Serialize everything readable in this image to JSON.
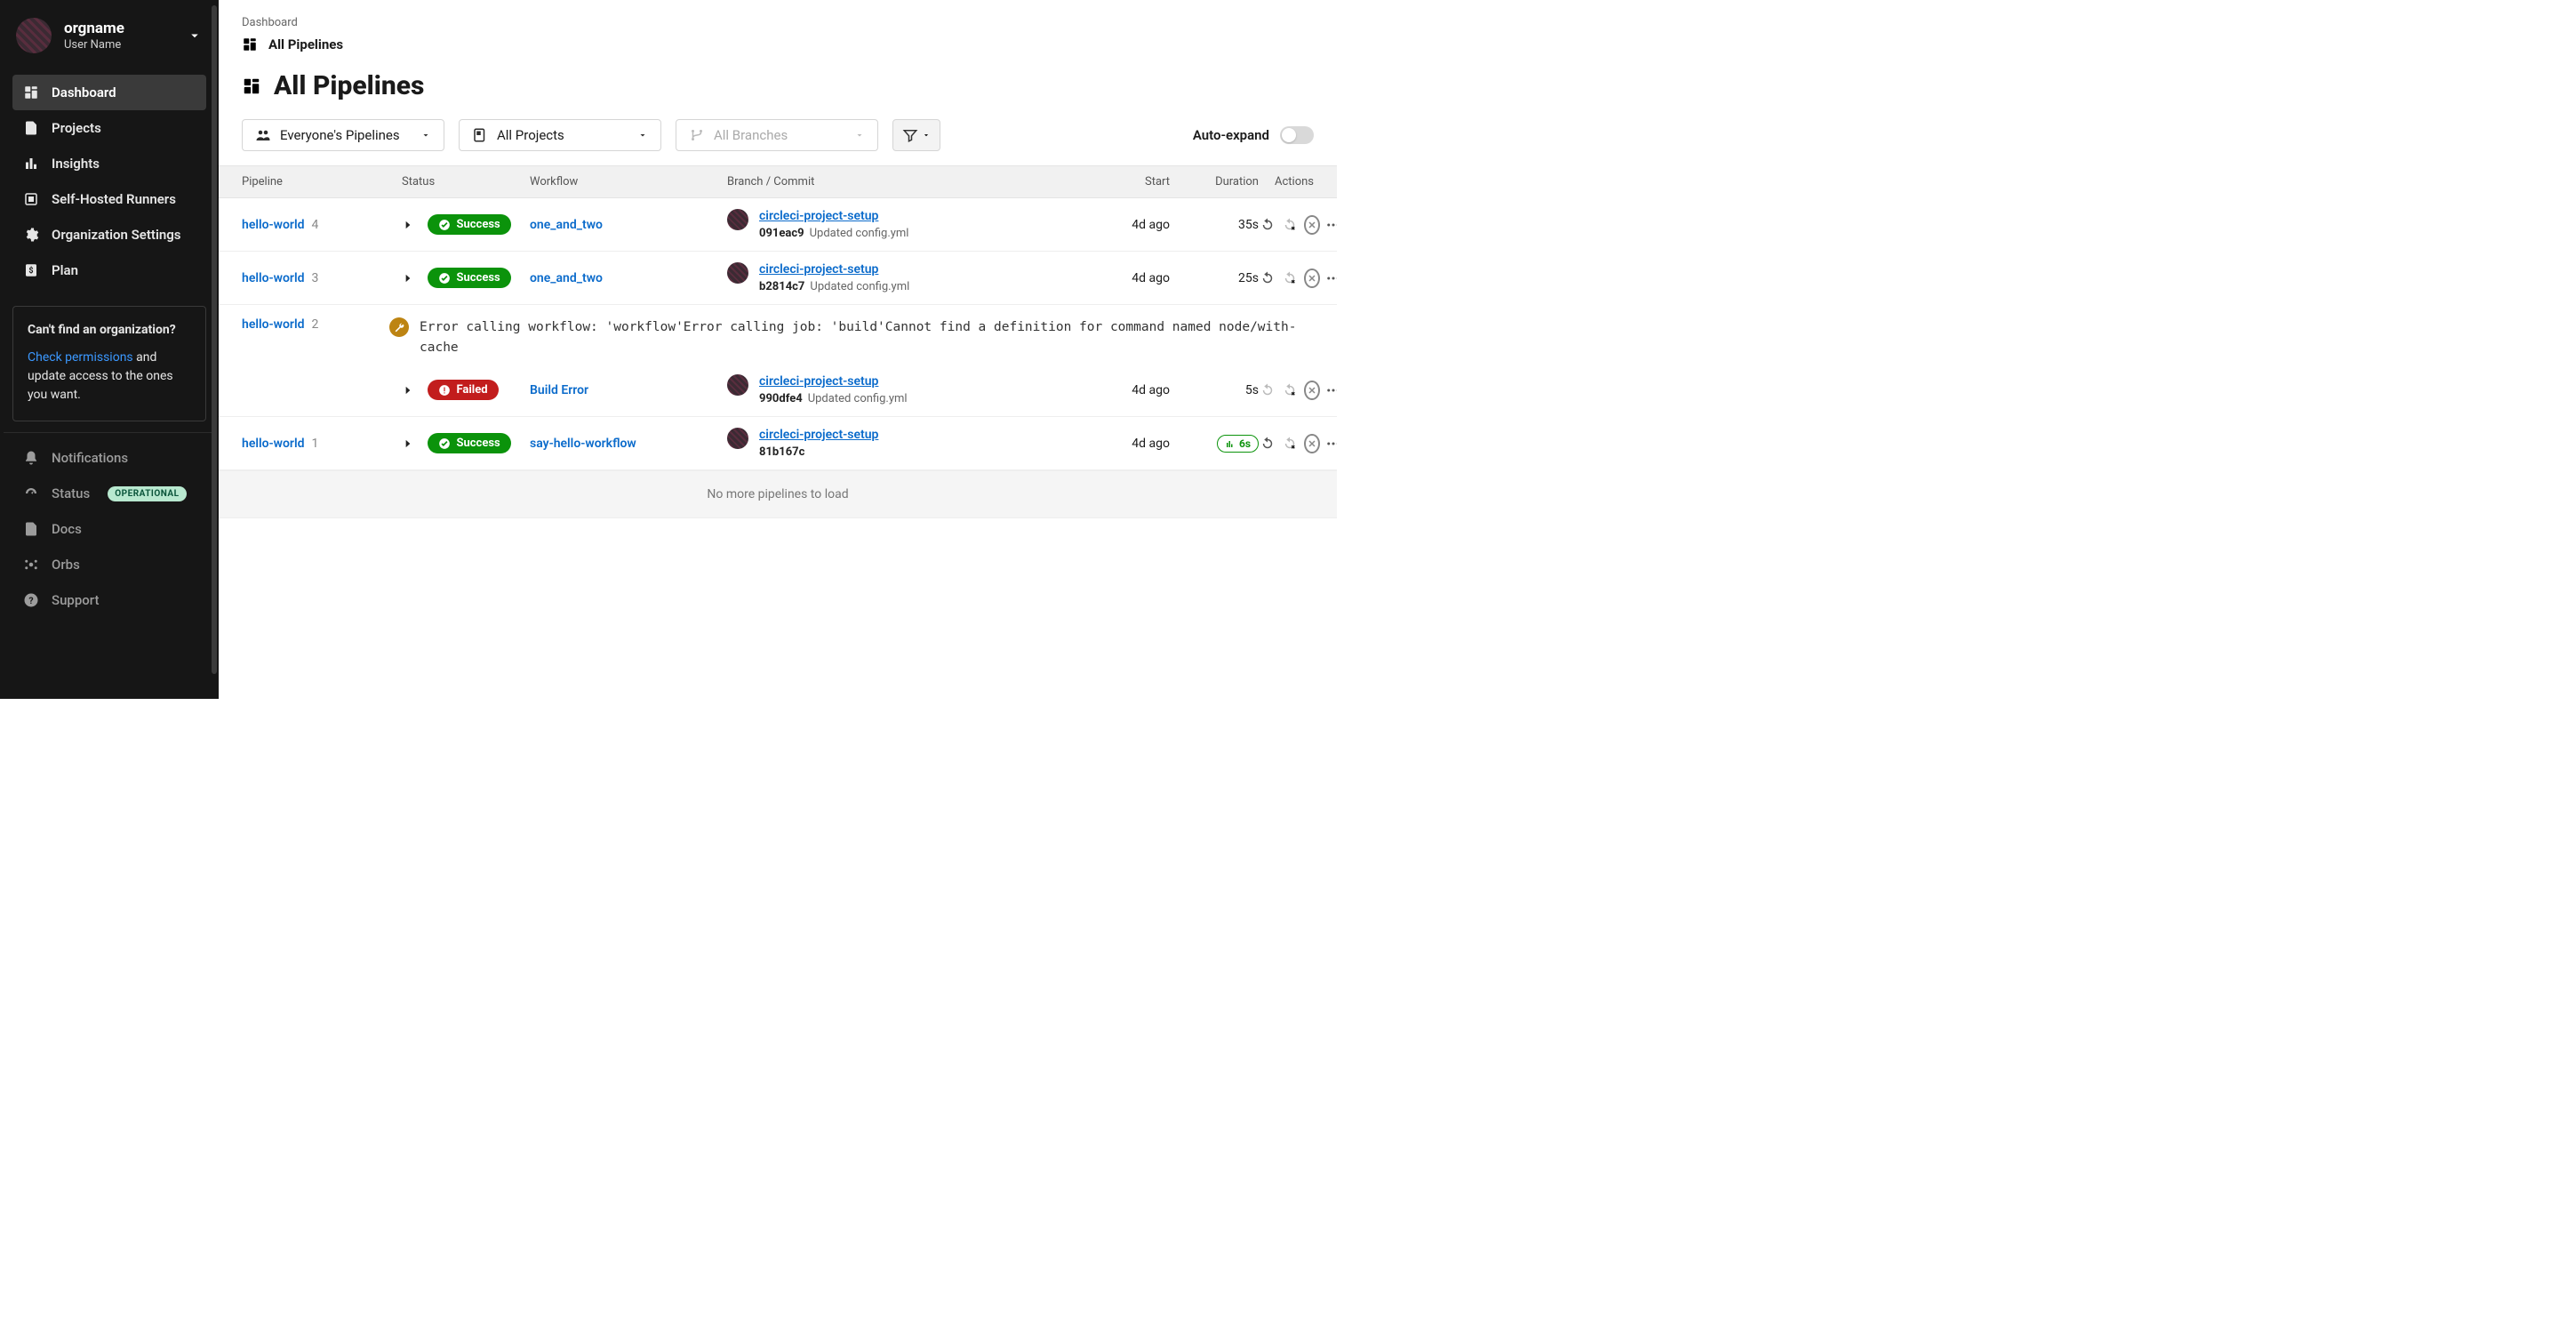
{
  "sidebar": {
    "org_name": "orgname",
    "user_name": "User Name",
    "nav_primary": [
      {
        "id": "dashboard",
        "label": "Dashboard"
      },
      {
        "id": "projects",
        "label": "Projects"
      },
      {
        "id": "insights",
        "label": "Insights"
      },
      {
        "id": "runners",
        "label": "Self-Hosted Runners"
      },
      {
        "id": "orgsettings",
        "label": "Organization Settings"
      },
      {
        "id": "plan",
        "label": "Plan"
      }
    ],
    "hint": {
      "title": "Can't find an organization?",
      "link_text": "Check permissions",
      "rest": " and update access to the ones you want."
    },
    "nav_secondary": [
      {
        "id": "notifications",
        "label": "Notifications"
      },
      {
        "id": "status",
        "label": "Status",
        "pill": "OPERATIONAL"
      },
      {
        "id": "docs",
        "label": "Docs"
      },
      {
        "id": "orbs",
        "label": "Orbs"
      },
      {
        "id": "support",
        "label": "Support"
      }
    ]
  },
  "main": {
    "breadcrumb": "Dashboard",
    "header_label": "All Pipelines",
    "page_title": "All Pipelines",
    "filters": {
      "owner": "Everyone's Pipelines",
      "project": "All Projects",
      "branch_placeholder": "All Branches"
    },
    "auto_expand_label": "Auto-expand",
    "columns": {
      "pipeline": "Pipeline",
      "status": "Status",
      "workflow": "Workflow",
      "branch": "Branch / Commit",
      "start": "Start",
      "duration": "Duration",
      "actions": "Actions"
    },
    "rows": [
      {
        "pipeline": "hello-world",
        "num": "4",
        "status": "Success",
        "status_kind": "success",
        "workflow": "one_and_two",
        "branch": "circleci-project-setup",
        "commit_sha": "091eac9",
        "commit_msg": "Updated config.yml",
        "start": "4d ago",
        "duration": "35s"
      },
      {
        "pipeline": "hello-world",
        "num": "3",
        "status": "Success",
        "status_kind": "success",
        "workflow": "one_and_two",
        "branch": "circleci-project-setup",
        "commit_sha": "b2814c7",
        "commit_msg": "Updated config.yml",
        "start": "4d ago",
        "duration": "25s"
      },
      {
        "pipeline": "hello-world",
        "num": "2",
        "status": "Failed",
        "status_kind": "failed",
        "workflow": "Build Error",
        "branch": "circleci-project-setup",
        "commit_sha": "990dfe4",
        "commit_msg": "Updated config.yml",
        "start": "4d ago",
        "duration": "5s",
        "error": "Error calling workflow: 'workflow'Error calling job: 'build'Cannot find a definition for command named node/with-cache"
      },
      {
        "pipeline": "hello-world",
        "num": "1",
        "status": "Success",
        "status_kind": "success",
        "workflow": "say-hello-workflow",
        "branch": "circleci-project-setup",
        "commit_sha": "81b167c",
        "commit_msg": "",
        "start": "4d ago",
        "duration": "6s",
        "duration_pill": true
      }
    ],
    "no_more": "No more pipelines to load"
  }
}
